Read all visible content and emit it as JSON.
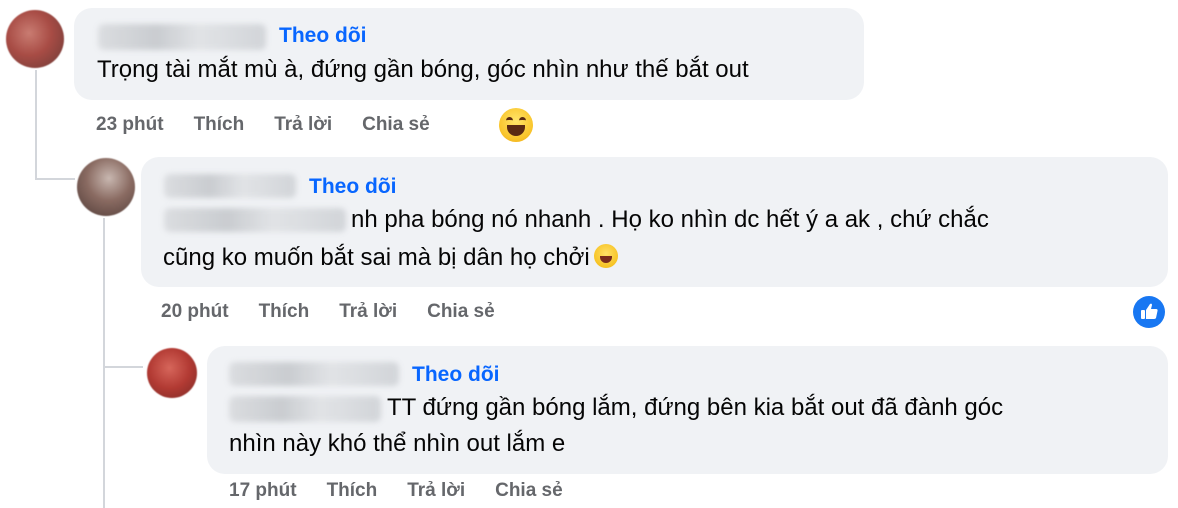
{
  "comments": [
    {
      "follow_label": "Theo dõi",
      "text_lines": [
        "Trọng tài mắt mù à, đứng gần bóng, góc nhìn như thế bắt out"
      ],
      "time": "23 phút",
      "like_label": "Thích",
      "reply_label": "Trả lời",
      "share_label": "Chia sẻ",
      "reaction": "haha-reaction-icon"
    },
    {
      "follow_label": "Theo dõi",
      "text_lines": [
        "nh pha bóng nó nhanh . Họ ko nhìn dc hết ý a ak , chứ chắc",
        "cũng ko muốn bắt sai mà bị dân họ chởi"
      ],
      "inline_emoji": "laughing-tears-emoji",
      "time": "20 phút",
      "like_label": "Thích",
      "reply_label": "Trả lời",
      "share_label": "Chia sẻ",
      "reaction": "like-reaction-icon"
    },
    {
      "follow_label": "Theo dõi",
      "text_lines": [
        "TT đứng gần bóng lắm, đứng bên kia bắt out đã đành góc",
        "nhìn này khó thể nhìn out lắm e"
      ],
      "time": "17 phút",
      "like_label": "Thích",
      "reply_label": "Trả lời",
      "share_label": "Chia sẻ"
    }
  ],
  "colors": {
    "accent": "#0866ff",
    "bubble": "#f0f2f5",
    "meta_text": "#65676b",
    "like_badge": "#1877f2"
  }
}
